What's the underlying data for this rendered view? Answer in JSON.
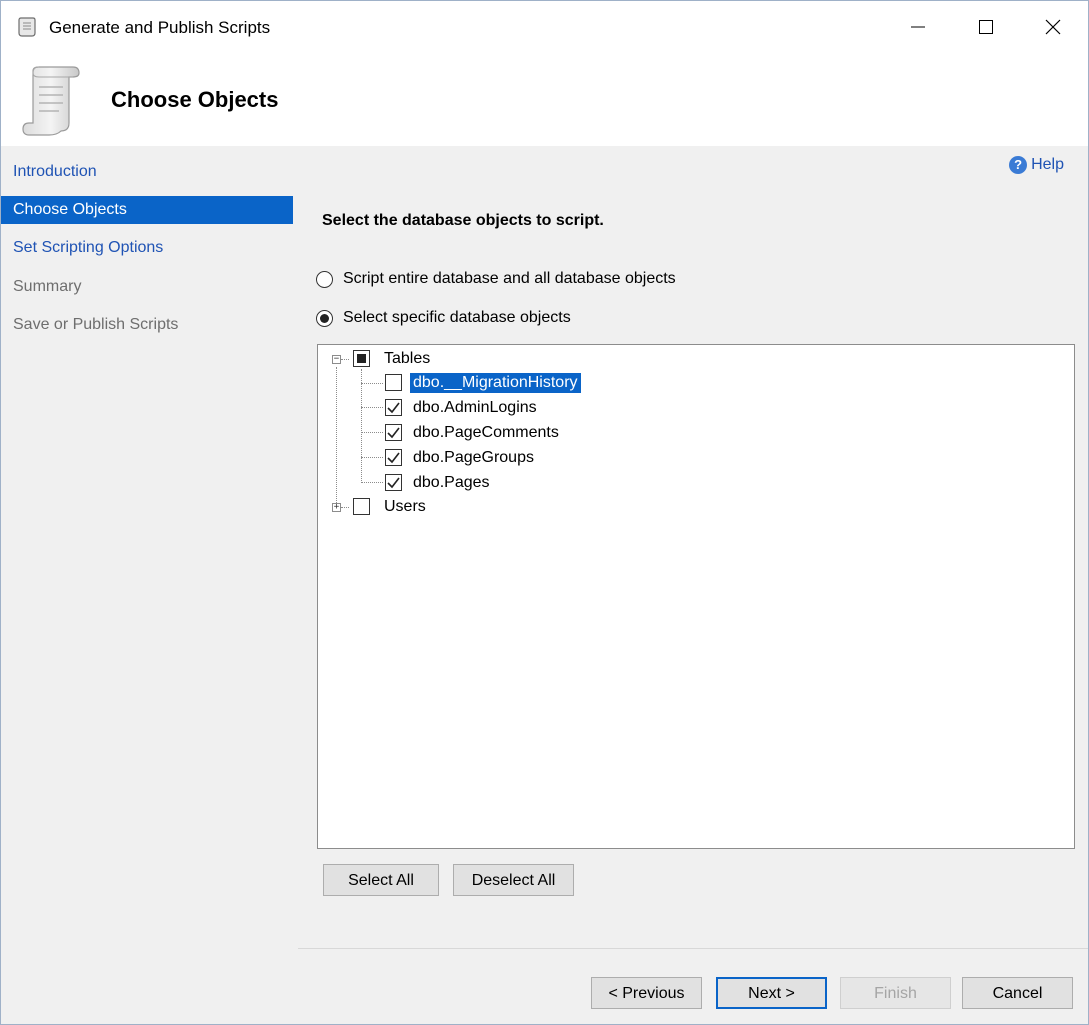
{
  "window": {
    "title": "Generate and Publish Scripts",
    "icon": "scroll-icon",
    "controls": [
      "minimize-icon",
      "maximize-icon",
      "close-icon"
    ]
  },
  "header": {
    "title": "Choose Objects",
    "icon": "scroll-icon"
  },
  "sidebar": {
    "items": [
      {
        "label": "Introduction",
        "state": "link"
      },
      {
        "label": "Choose Objects",
        "state": "active"
      },
      {
        "label": "Set Scripting Options",
        "state": "link"
      },
      {
        "label": "Summary",
        "state": "disabled"
      },
      {
        "label": "Save or Publish Scripts",
        "state": "disabled"
      }
    ]
  },
  "main": {
    "help_label": "Help",
    "instruction": "Select the database objects to script.",
    "options": [
      {
        "label": "Script entire database and all database objects",
        "checked": false
      },
      {
        "label": "Select specific database objects",
        "checked": true
      }
    ],
    "tree": {
      "nodes": [
        {
          "label": "Tables",
          "expanded": true,
          "state": "indeterminate",
          "children": [
            {
              "label": "dbo.__MigrationHistory",
              "checked": false,
              "selected": true
            },
            {
              "label": "dbo.AdminLogins",
              "checked": true
            },
            {
              "label": "dbo.PageComments",
              "checked": true
            },
            {
              "label": "dbo.PageGroups",
              "checked": true
            },
            {
              "label": "dbo.Pages",
              "checked": true
            }
          ]
        },
        {
          "label": "Users",
          "expanded": false,
          "state": "unchecked",
          "children": []
        }
      ]
    },
    "select_all_label": "Select All",
    "deselect_all_label": "Deselect All"
  },
  "footer": {
    "previous_label": "< Previous",
    "next_label": "Next >",
    "finish_label": "Finish",
    "cancel_label": "Cancel"
  },
  "colors": {
    "accent": "#0a64c8",
    "link": "#1f53b4",
    "panel": "#f0f0f0"
  }
}
